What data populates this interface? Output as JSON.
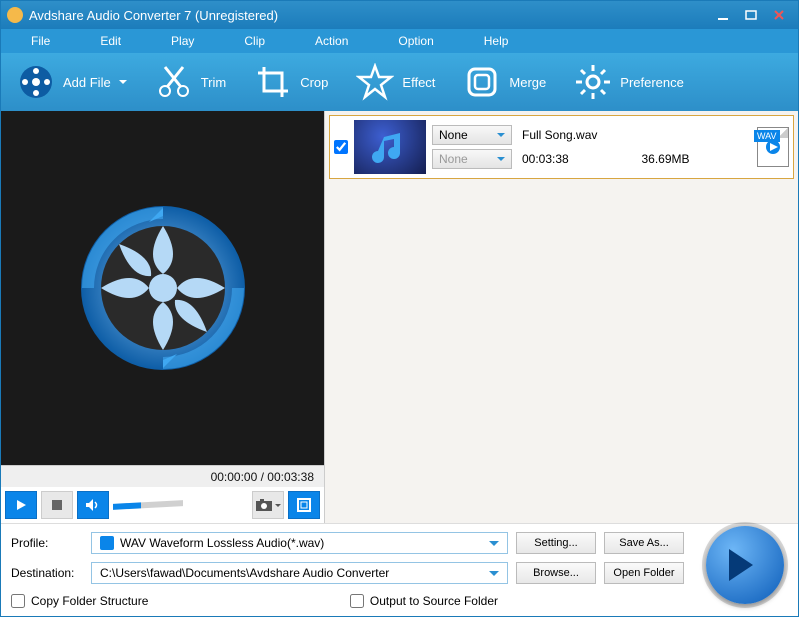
{
  "window": {
    "title": "Avdshare Audio Converter 7 (Unregistered)"
  },
  "menu": {
    "file": "File",
    "edit": "Edit",
    "play": "Play",
    "clip": "Clip",
    "action": "Action",
    "option": "Option",
    "help": "Help"
  },
  "toolbar": {
    "addfile": "Add File",
    "trim": "Trim",
    "crop": "Crop",
    "effect": "Effect",
    "merge": "Merge",
    "preference": "Preference"
  },
  "preview": {
    "time": "00:00:00 / 00:03:38"
  },
  "file": {
    "name": "Full Song.wav",
    "duration": "00:03:38",
    "size": "36.69MB",
    "dropdown1": "None",
    "dropdown2": "None",
    "format_badge": "WAV"
  },
  "profile": {
    "label": "Profile:",
    "value": "WAV Waveform Lossless Audio(*.wav)",
    "setting": "Setting...",
    "saveas": "Save As..."
  },
  "destination": {
    "label": "Destination:",
    "value": "C:\\Users\\fawad\\Documents\\Avdshare Audio Converter",
    "browse": "Browse...",
    "open": "Open Folder"
  },
  "options": {
    "copy_folder": "Copy Folder Structure",
    "output_source": "Output to Source Folder"
  }
}
